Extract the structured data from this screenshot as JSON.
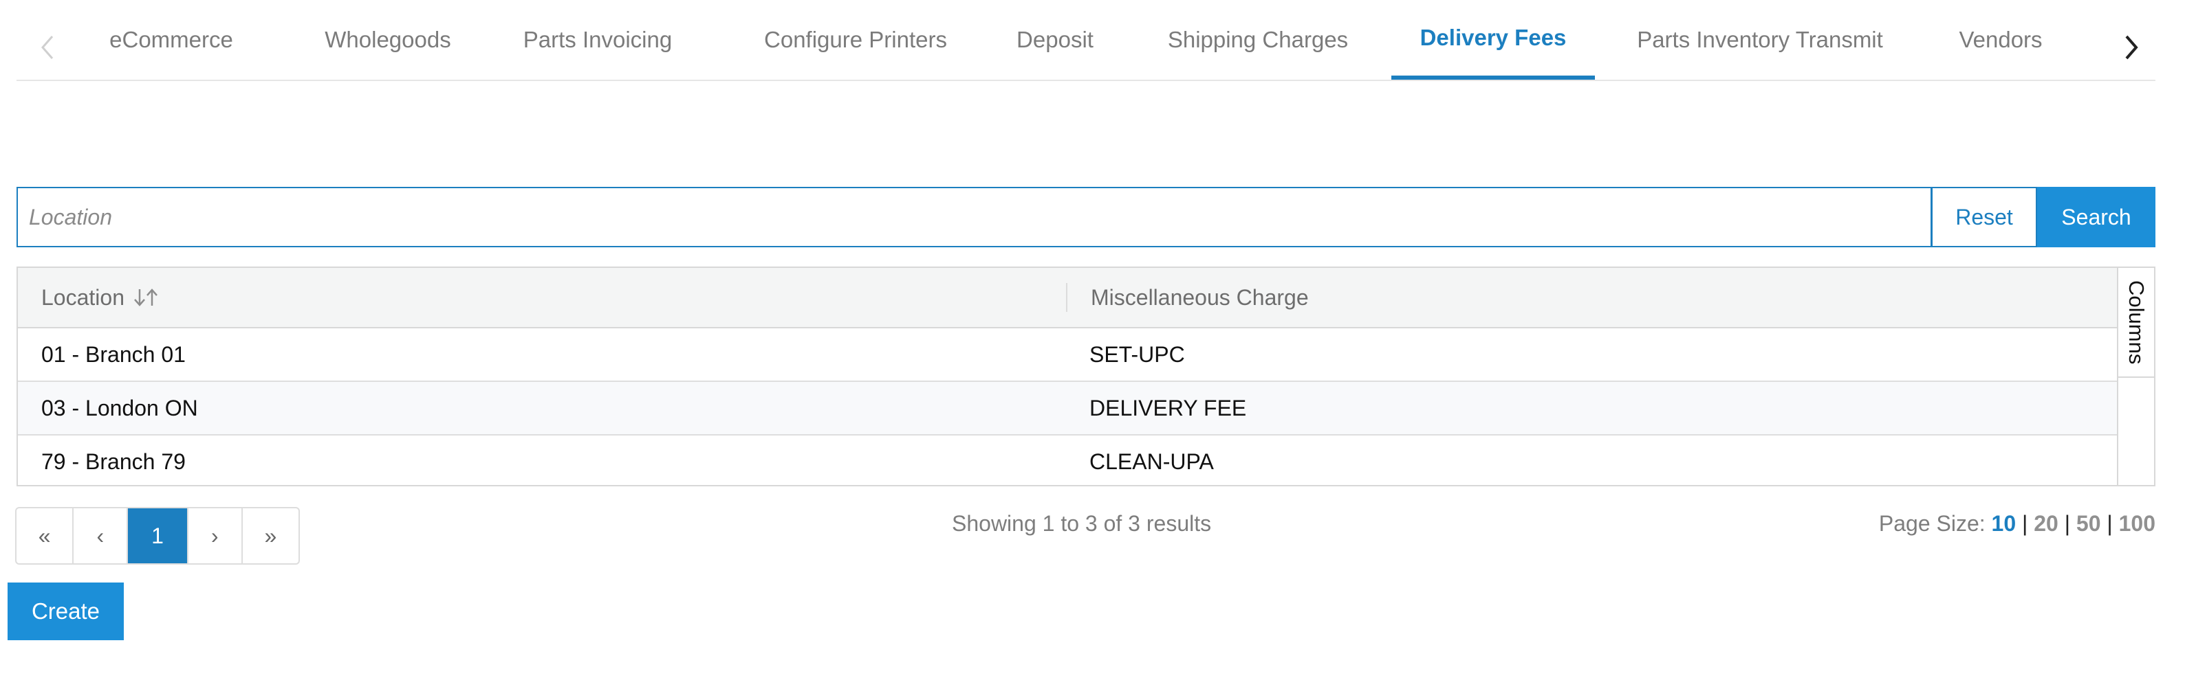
{
  "tabs": [
    {
      "label": "eCommerce",
      "active": false
    },
    {
      "label": "Wholegoods",
      "active": false
    },
    {
      "label": "Parts Invoicing",
      "active": false
    },
    {
      "label": "Configure Printers",
      "active": false
    },
    {
      "label": "Deposit",
      "active": false
    },
    {
      "label": "Shipping Charges",
      "active": false
    },
    {
      "label": "Delivery Fees",
      "active": true
    },
    {
      "label": "Parts Inventory Transmit",
      "active": false
    },
    {
      "label": "Vendors",
      "active": false
    }
  ],
  "search": {
    "placeholder": "Location",
    "value": "",
    "reset_label": "Reset",
    "search_label": "Search"
  },
  "table": {
    "columns": [
      "Location",
      "Miscellaneous Charge"
    ],
    "rows": [
      [
        "01 - Branch 01",
        "SET-UPC"
      ],
      [
        "03 - London ON",
        "DELIVERY FEE"
      ],
      [
        "79 - Branch 79",
        "CLEAN-UPA"
      ]
    ],
    "columns_toggle_label": "Columns"
  },
  "pagination": {
    "first": "«",
    "prev": "‹",
    "current": "1",
    "next": "›",
    "last": "»",
    "showing": "Showing 1 to 3 of 3 results",
    "page_size_label": "Page Size: ",
    "page_sizes": [
      "10",
      "20",
      "50",
      "100"
    ],
    "page_size_selected": "10"
  },
  "create_label": "Create",
  "colors": {
    "accent": "#1c7fc0",
    "button": "#1c8fd8"
  },
  "icons": {
    "tab_prev": "chevron-left-icon",
    "tab_next": "chevron-right-icon",
    "sort": "sort-arrows-icon"
  }
}
